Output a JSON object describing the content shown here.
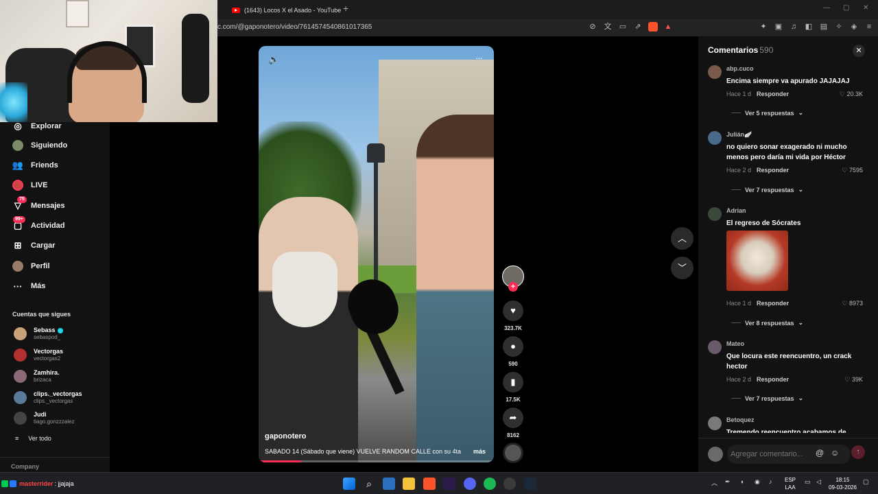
{
  "browser": {
    "tab_title": "(1643) Locos X el Asado - YouTube",
    "new_tab": "+",
    "url": "c.com/@gaponotero/video/7614574540861017365"
  },
  "sidebar": {
    "items": [
      {
        "label": "Explorar",
        "icon": "compass-icon"
      },
      {
        "label": "Siguiendo",
        "icon": "following-avatar-icon"
      },
      {
        "label": "Friends",
        "icon": "friends-icon"
      },
      {
        "label": "LIVE",
        "icon": "live-icon"
      },
      {
        "label": "Mensajes",
        "icon": "messages-icon",
        "badge": "75"
      },
      {
        "label": "Actividad",
        "icon": "activity-icon",
        "badge": "99+"
      },
      {
        "label": "Cargar",
        "icon": "upload-icon"
      },
      {
        "label": "Perfil",
        "icon": "profile-icon"
      },
      {
        "label": "Más",
        "icon": "more-icon"
      }
    ],
    "following_title": "Cuentas que sigues",
    "accounts": [
      {
        "name": "Sebass",
        "handle": "sebaspod_",
        "verified": true
      },
      {
        "name": "Vectorgas",
        "handle": "vectorgas2"
      },
      {
        "name": "Zamhira.",
        "handle": "brizaca"
      },
      {
        "name": "clips._vectorgas",
        "handle": "clips._vectorgas"
      },
      {
        "name": "Judi",
        "handle": "tiago.gonzzzalez"
      }
    ],
    "see_all": "Ver todo",
    "company": "Company"
  },
  "video": {
    "author": "gaponotero",
    "description": "SABADO 14 (Sábado que viene) VUELVE RANDOM CALLE con su 4ta",
    "more": "más",
    "progress": 0.18
  },
  "actions": {
    "likes": "323.7K",
    "comments": "590",
    "saves": "17.5K",
    "shares": "8162"
  },
  "comments_panel": {
    "title": "Comentarios",
    "count": "590",
    "reply_label": "Responder",
    "items": [
      {
        "user": "abp.cuco",
        "text": "Encima siempre va apurado JAJAJAJ",
        "time": "Hace 1 d",
        "likes": "20.3K",
        "more": "Ver 5 respuestas"
      },
      {
        "user": "Julián🪽",
        "text": "no quiero sonar exagerado ni mucho menos pero daría mi vida por Héctor",
        "time": "Hace 2 d",
        "likes": "7595",
        "more": "Ver 7 respuestas"
      },
      {
        "user": "Adrian",
        "text": "El regreso de Sócrates",
        "time": "Hace 1 d",
        "likes": "8973",
        "more": "Ver 8 respuestas"
      },
      {
        "user": "Mateo",
        "text": "Que locura este reencuentro, un crack hector",
        "time": "Hace 2 d",
        "likes": "39K",
        "more": "Ver 7 respuestas"
      },
      {
        "user": "Betoquez",
        "text": "Tremendo reencuentro acabamos de"
      }
    ],
    "input_placeholder": "Agregar comentario..."
  },
  "taskbar": {
    "chat_user": "masterrider",
    "chat_msg": ": jjajaja",
    "lang_top": "ESP",
    "lang_bottom": "LAA",
    "time": "18:15",
    "date": "09-03-2026"
  },
  "colors": {
    "accent": "#fe2c55",
    "background": "#121212"
  }
}
